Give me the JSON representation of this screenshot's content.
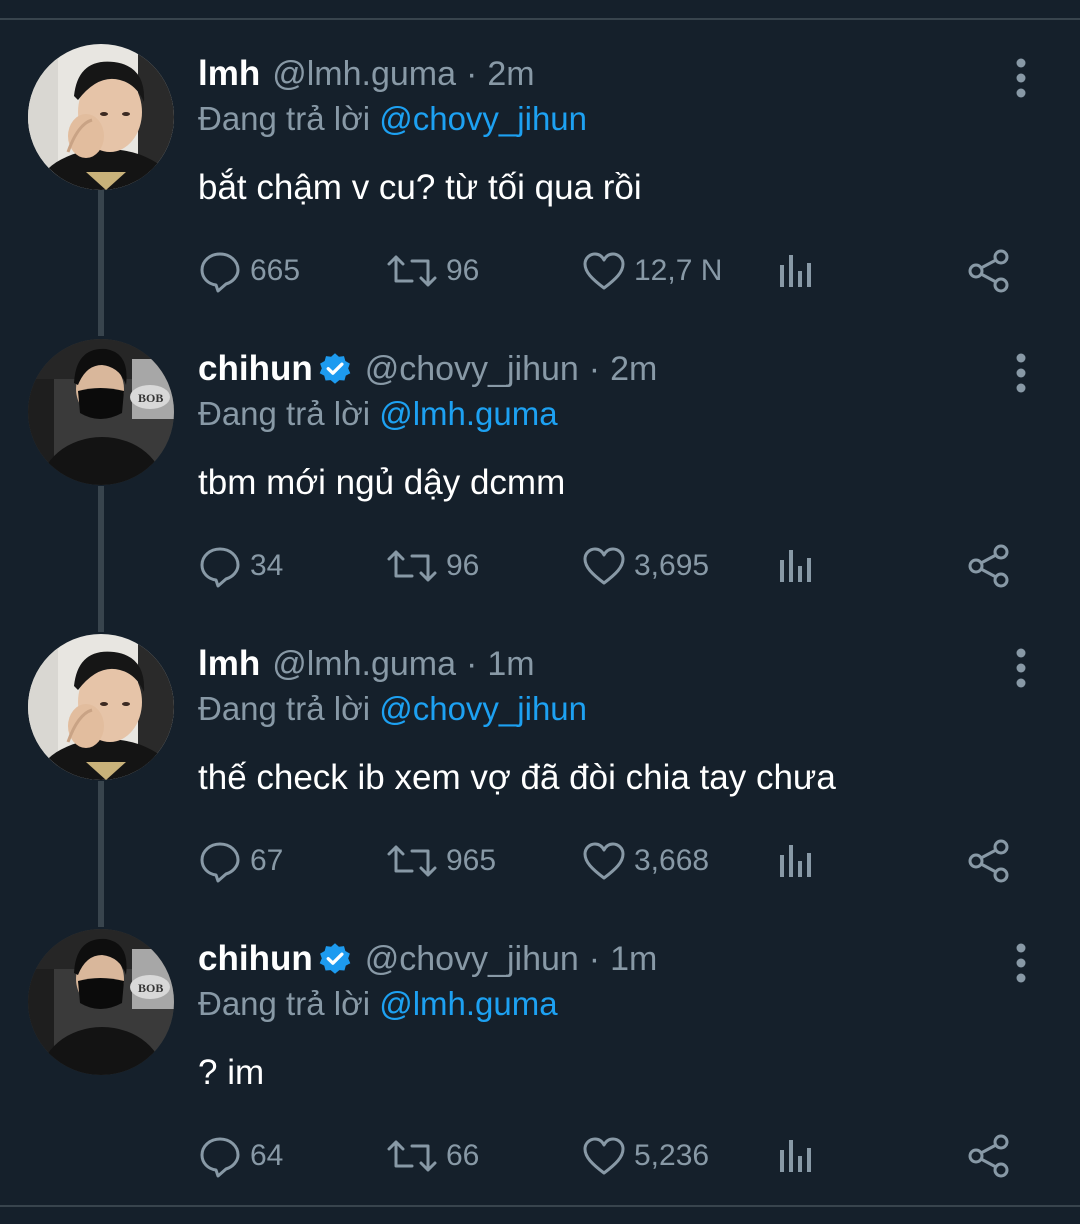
{
  "tweets": [
    {
      "name": "lmh",
      "verified": false,
      "handle": "@lmh.guma",
      "time": "2m",
      "reply_prefix": "Đang trả lời",
      "reply_to": "@chovy_jihun",
      "text": "bắt chậm v cu? từ tối qua rồi",
      "replies": "665",
      "retweets": "96",
      "likes": "12,7 N"
    },
    {
      "name": "chihun",
      "verified": true,
      "handle": "@chovy_jihun",
      "time": "2m",
      "reply_prefix": "Đang trả lời",
      "reply_to": "@lmh.guma",
      "text": "tbm mới ngủ dậy dcmm",
      "replies": "34",
      "retweets": "96",
      "likes": "3,695"
    },
    {
      "name": "lmh",
      "verified": false,
      "handle": "@lmh.guma",
      "time": "1m",
      "reply_prefix": "Đang trả lời",
      "reply_to": "@chovy_jihun",
      "text": "thế check ib xem vợ đã đòi chia tay chưa",
      "replies": "67",
      "retweets": "965",
      "likes": "3,668"
    },
    {
      "name": "chihun",
      "verified": true,
      "handle": "@chovy_jihun",
      "time": "1m",
      "reply_prefix": "Đang trả lời",
      "reply_to": "@lmh.guma",
      "text": "? im",
      "replies": "64",
      "retweets": "66",
      "likes": "5,236"
    }
  ],
  "separator": "·",
  "avatar_badge_text": "BOB",
  "icons": {
    "verified": "verified-badge-icon",
    "more": "more-vertical-icon",
    "reply": "reply-bubble-icon",
    "retweet": "retweet-icon",
    "like": "heart-icon",
    "stats": "analytics-icon",
    "share": "share-icon"
  },
  "colors": {
    "background": "#15202b",
    "text_primary": "#ffffff",
    "text_secondary": "#8899a6",
    "accent": "#1da1f2",
    "divider": "#38444d"
  }
}
